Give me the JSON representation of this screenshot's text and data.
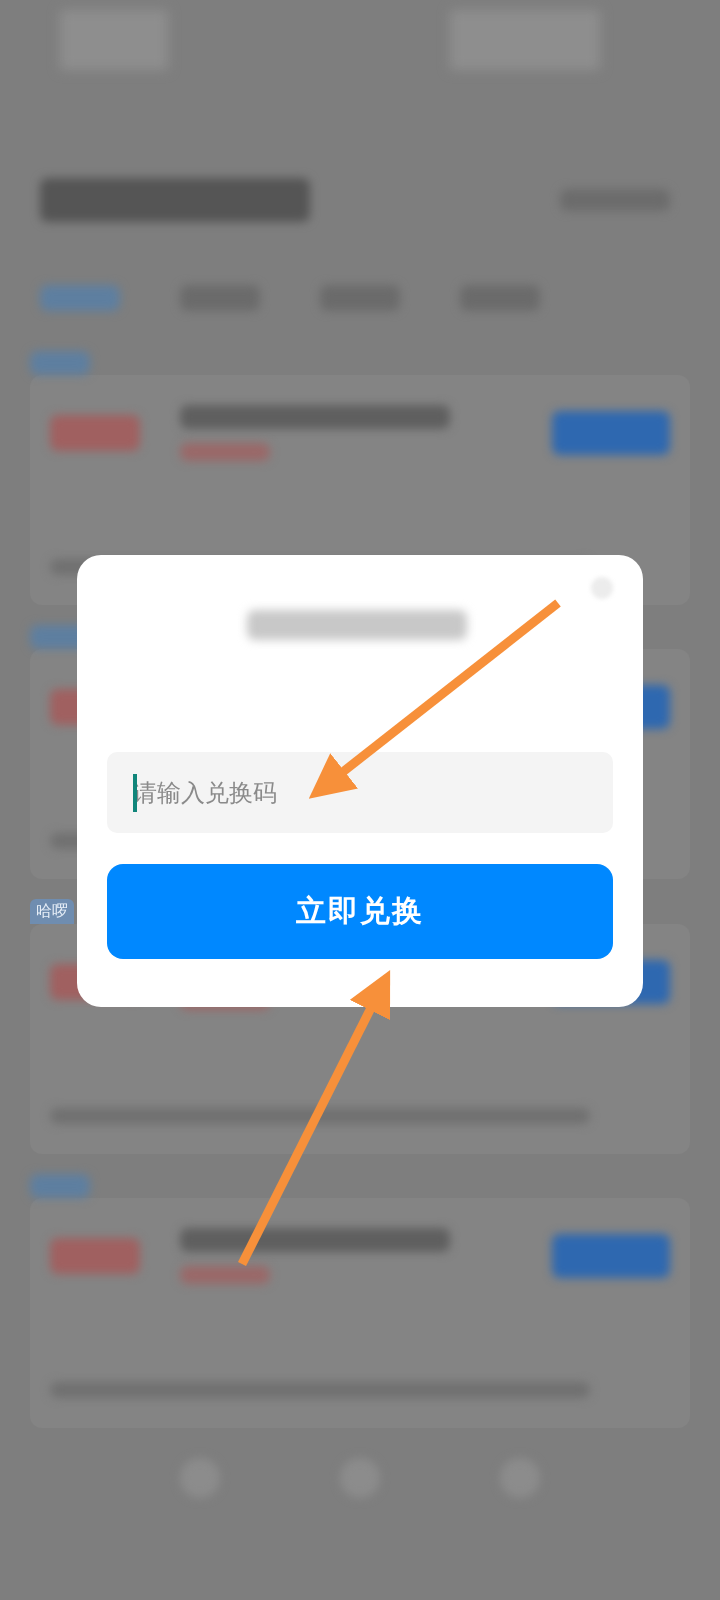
{
  "background": {
    "tabs": [
      {
        "selected": true
      },
      {
        "selected": false
      },
      {
        "selected": false
      },
      {
        "selected": false
      }
    ],
    "cards": [
      {
        "kind": "blurred"
      },
      {
        "kind": "blurred"
      },
      {
        "kind": "tagged",
        "tag": "哈啰"
      },
      {
        "kind": "blurred"
      }
    ]
  },
  "dialog": {
    "code_field": {
      "placeholder": "请输入兑换码",
      "focused": true
    },
    "redeem_button": "立即兑换"
  }
}
